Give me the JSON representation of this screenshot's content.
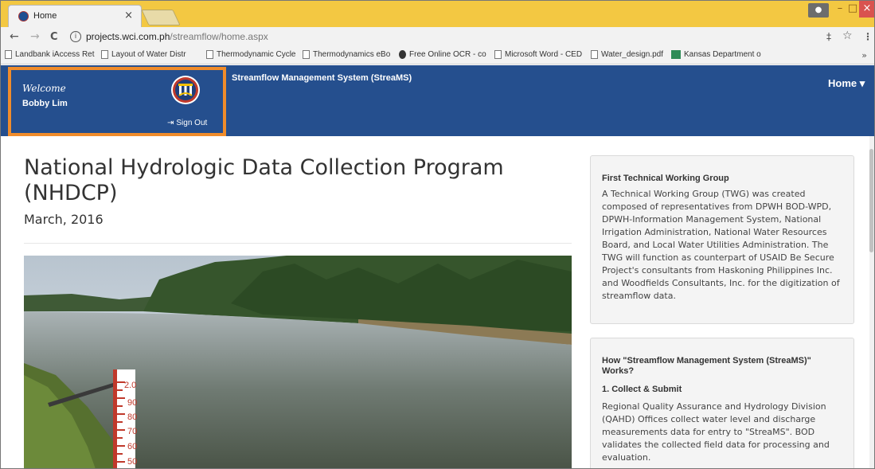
{
  "browser": {
    "tab_title": "Home",
    "tab_close": "×",
    "url_host": "projects.wci.com.ph",
    "url_path": "/streamflow/home.aspx",
    "back": "←",
    "forward": "→",
    "reload": "C",
    "info": "i",
    "pin_icon": "‡",
    "star_icon": "☆",
    "menu_icon": "⋮",
    "window_min": "–",
    "window_max": "🗗",
    "window_close": "×",
    "bookmarks": [
      "Landbank iAccess Ret",
      "Layout of Water Distr",
      "Thermodynamic Cycle",
      "Thermodynamics eBo",
      "Free Online OCR - co",
      "Microsoft Word - CED",
      "Water_design.pdf",
      "Kansas Department o"
    ],
    "bookmarks_more": "»"
  },
  "header": {
    "welcome_label": "Welcome",
    "user_name": "Bobby Lim",
    "signout_label": "Sign Out",
    "signout_icon": "⇥",
    "site_title": "Streamflow Management System (StreaMS)",
    "home_menu": "Home",
    "home_caret": "▾"
  },
  "main": {
    "title": "National Hydrologic Data Collection Program (NHDCP)",
    "date": "March, 2016",
    "gauge_marks": [
      "2.0",
      "90",
      "80",
      "70",
      "60",
      "50"
    ]
  },
  "sidebar": {
    "panel1": {
      "title": "First Technical Working Group",
      "body": "A Technical Working Group (TWG) was created composed of representatives from DPWH BOD-WPD, DPWH-Information Management System, National Irrigation Administration, National Water Resources Board, and Local Water Utilities Administration. The TWG will function as counterpart of USAID Be Secure Project's consultants from Haskoning Philippines Inc. and Woodfields Consultants, Inc. for the digitization of streamflow data."
    },
    "panel2": {
      "title": "How \"Streamflow Management System (StreaMS)\" Works?",
      "step_title": "1. Collect & Submit",
      "body": "Regional Quality Assurance and Hydrology Division (QAHD) Offices collect water level and discharge measurements data for entry to \"StreaMS\". BOD validates the collected field data for processing and evaluation."
    }
  },
  "colors": {
    "header_blue": "#254f8e",
    "welcome_border": "#f08c2b",
    "chrome_yellow": "#f3c842"
  }
}
